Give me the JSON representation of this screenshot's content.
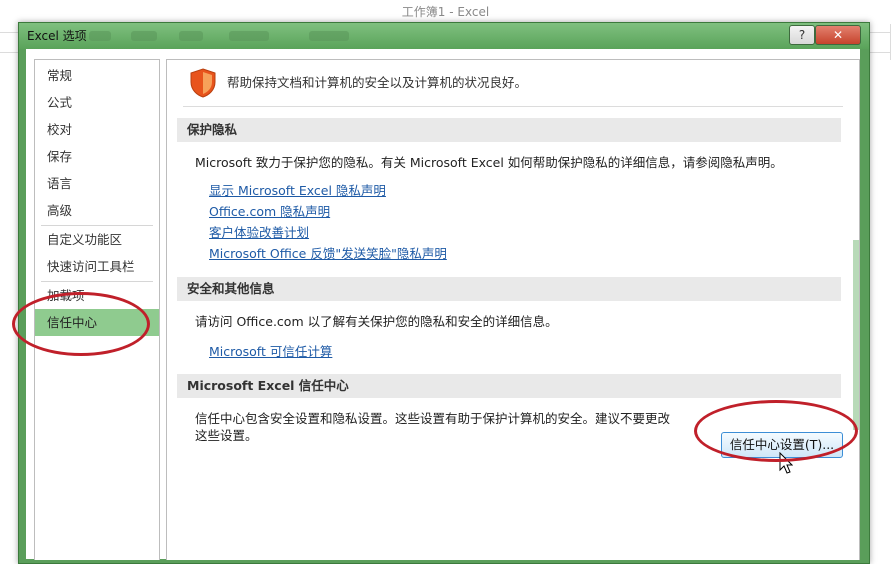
{
  "app": {
    "window_title": "工作簿1 - Excel"
  },
  "dialog": {
    "title": "Excel 选项",
    "help_label": "?",
    "close_label": "✕"
  },
  "nav": {
    "items": [
      {
        "label": "常规"
      },
      {
        "label": "公式"
      },
      {
        "label": "校对"
      },
      {
        "label": "保存"
      },
      {
        "label": "语言"
      },
      {
        "label": "高级"
      },
      {
        "label": "自定义功能区"
      },
      {
        "label": "快速访问工具栏"
      },
      {
        "label": "加载项"
      },
      {
        "label": "信任中心",
        "selected": true
      }
    ]
  },
  "main": {
    "header_text": "帮助保持文档和计算机的安全以及计算机的状况良好。",
    "shield_icon": "shield-icon",
    "sections": {
      "privacy": {
        "title": "保护隐私",
        "text": "Microsoft 致力于保护您的隐私。有关 Microsoft Excel 如何帮助保护隐私的详细信息，请参阅隐私声明。",
        "links": [
          "显示 Microsoft Excel 隐私声明",
          "Office.com 隐私声明",
          "客户体验改善计划",
          "Microsoft Office 反馈\"发送笑脸\"隐私声明"
        ]
      },
      "security": {
        "title": "安全和其他信息",
        "text": "请访问 Office.com 以了解有关保护您的隐私和安全的详细信息。",
        "link": "Microsoft 可信任计算"
      },
      "trust_center": {
        "title": "Microsoft Excel 信任中心",
        "text_line1": "信任中心包含安全设置和隐私设置。这些设置有助于保护计算机的安全。建议不要更改",
        "text_line2": "这些设置。",
        "button_label": "信任中心设置(T)..."
      }
    }
  },
  "colors": {
    "dialog_frame": "#5a9e5a",
    "nav_selected": "#8fcb8f",
    "link": "#1e5aa6",
    "annotation_red": "#c0202a"
  }
}
